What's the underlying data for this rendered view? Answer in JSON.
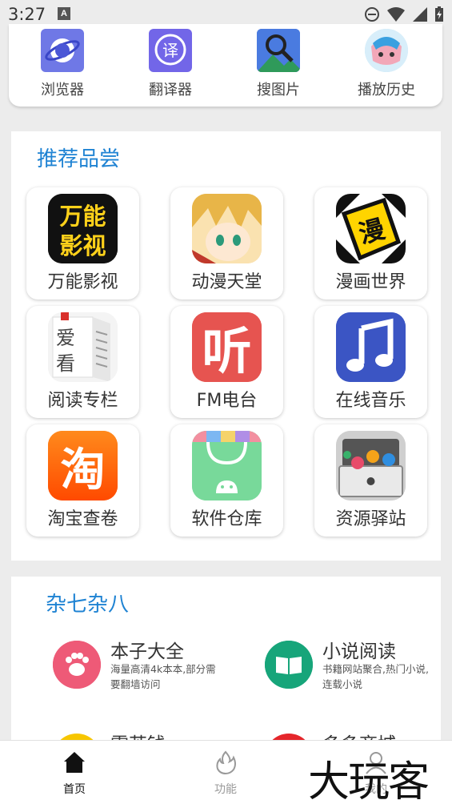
{
  "status_bar": {
    "time": "3:27",
    "notification_letter": "A"
  },
  "quick_access": [
    {
      "label": "浏览器",
      "icon": "browser-icon"
    },
    {
      "label": "翻译器",
      "icon": "translator-icon",
      "glyph": "译"
    },
    {
      "label": "搜图片",
      "icon": "image-search-icon"
    },
    {
      "label": "播放历史",
      "icon": "play-history-icon"
    }
  ],
  "recommend": {
    "title": "推荐品尝",
    "apps": [
      {
        "label": "万能影视",
        "icon": "video-app-icon",
        "icon_text": "万能影视"
      },
      {
        "label": "动漫天堂",
        "icon": "anime-app-icon"
      },
      {
        "label": "漫画世界",
        "icon": "comic-app-icon",
        "icon_text": "漫"
      },
      {
        "label": "阅读专栏",
        "icon": "reading-app-icon",
        "icon_text": "爱看"
      },
      {
        "label": "FM电台",
        "icon": "fm-radio-icon",
        "icon_text": "听"
      },
      {
        "label": "在线音乐",
        "icon": "music-note-icon"
      },
      {
        "label": "淘宝查卷",
        "icon": "taobao-icon",
        "icon_text": "淘"
      },
      {
        "label": "软件仓库",
        "icon": "app-store-bag-icon"
      },
      {
        "label": "资源驿站",
        "icon": "resource-box-icon"
      }
    ]
  },
  "misc": {
    "title": "杂七杂八",
    "items": [
      {
        "title": "本子大全",
        "desc": "海量高清4k本本,部分需要翻墙访问",
        "icon": "paw-icon",
        "color": "#ee5a77"
      },
      {
        "title": "小说阅读",
        "desc": "书籍网站聚合,热门小说,连载小说",
        "icon": "book-icon",
        "color": "#17a57a"
      },
      {
        "title": "需苦钱",
        "icon": "yellow-circle-icon",
        "color": "#f7c600"
      },
      {
        "title": "多多商城",
        "icon": "red-circle-icon",
        "color": "#e5262b"
      }
    ]
  },
  "bottom_nav": [
    {
      "label": "首页",
      "icon": "home-icon",
      "active": true
    },
    {
      "label": "功能",
      "icon": "fire-icon",
      "active": false
    },
    {
      "label": "我的",
      "icon": "user-icon",
      "active": false
    }
  ],
  "watermark": "大玩客",
  "colors": {
    "accent": "#1f83d3",
    "background": "#ececec"
  }
}
